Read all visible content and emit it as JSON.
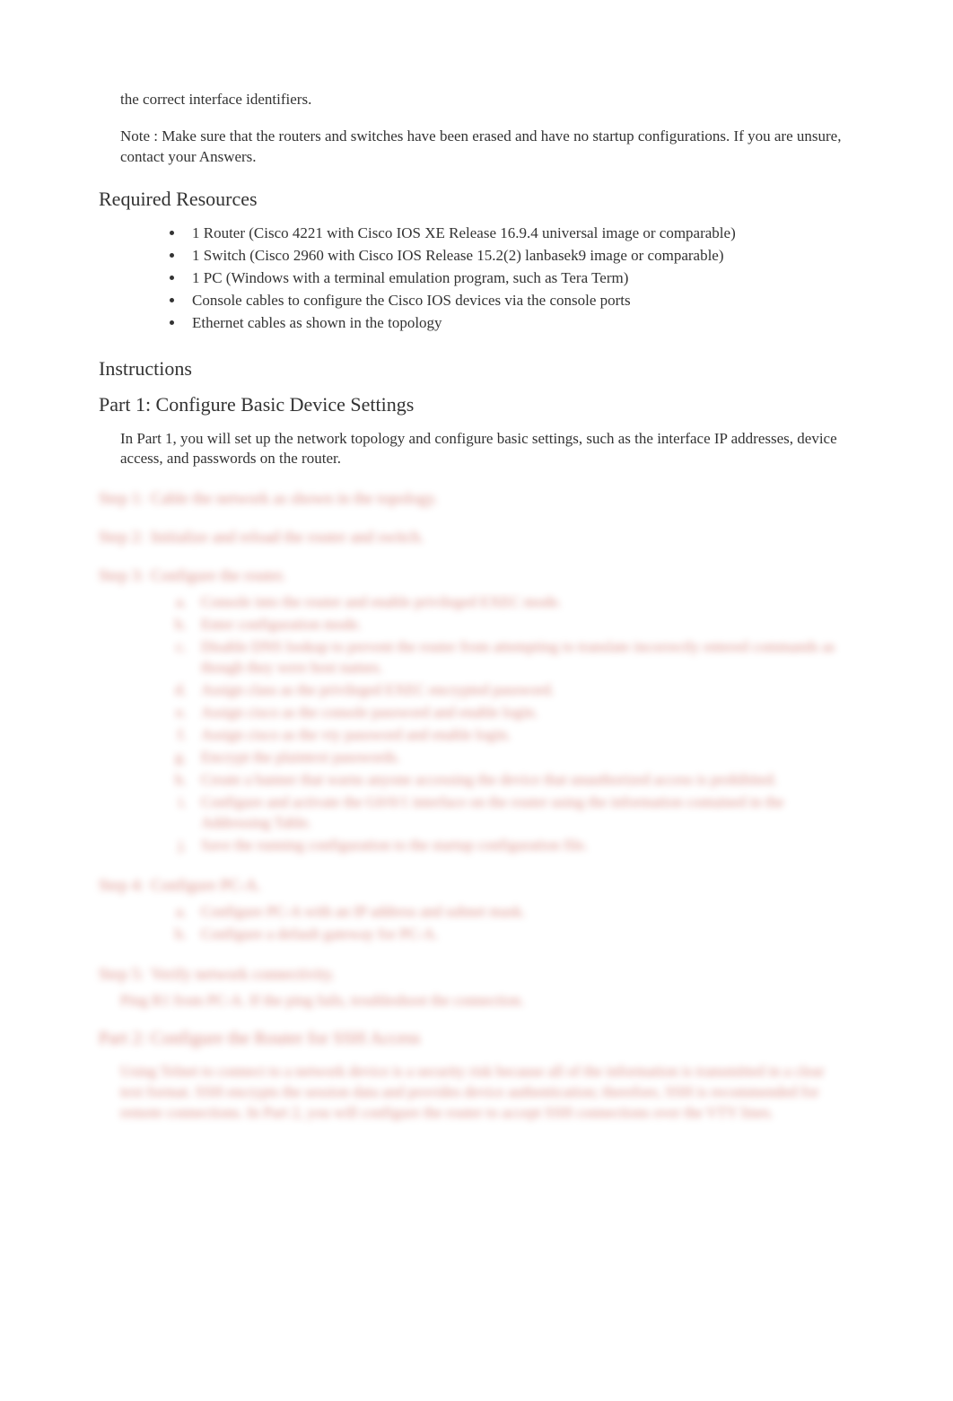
{
  "intro_tail": "the correct interface identifiers.",
  "note": "Note : Make sure that the routers and switches have been erased and have no startup configurations. If you are unsure, contact your Answers.",
  "required_resources_heading": "Required Resources",
  "resources": [
    "1 Router (Cisco 4221 with Cisco IOS XE Release 16.9.4 universal image or comparable)",
    "1 Switch (Cisco 2960 with Cisco IOS Release 15.2(2) lanbasek9 image or comparable)",
    "1 PC (Windows with a terminal emulation program, such as Tera Term)",
    "Console cables to configure the Cisco IOS devices via the console ports",
    "Ethernet cables as shown in the topology"
  ],
  "instructions_heading": "Instructions",
  "part1_heading": "Part 1:   Configure Basic Device Settings",
  "part1_intro": "In Part 1, you will set up the network topology and configure basic settings, such as the interface IP addresses, device access, and passwords on the router.",
  "step1": {
    "label": "Step 1:",
    "title": "Cable the network as shown in the topology."
  },
  "step2": {
    "label": "Step 2:",
    "title": "Initialize and reload the router and switch."
  },
  "step3": {
    "label": "Step 3:",
    "title": "Configure the router.",
    "items": [
      "Console into the router and enable privileged EXEC mode.",
      "Enter configuration mode.",
      "Disable DNS lookup to prevent the router from attempting to translate incorrectly entered commands as though they were host names.",
      "Assign class as the privileged EXEC encrypted password.",
      "Assign cisco as the console password and enable login.",
      "Assign cisco as the vty password and enable login.",
      "Encrypt the plaintext passwords.",
      "Create a banner that warns anyone accessing the device that unauthorized access is prohibited.",
      "Configure and activate the G0/0/1 interface on the router using the information contained in the Addressing Table.",
      "Save the running configuration to the startup configuration file."
    ]
  },
  "step4": {
    "label": "Step 4:",
    "title": "Configure PC-A.",
    "items": [
      "Configure PC-A with an IP address and subnet mask.",
      "Configure a default gateway for PC-A."
    ]
  },
  "step5": {
    "label": "Step 5:",
    "title": "Verify network connectivity.",
    "ping_text": "Ping R1 from PC-A. If the ping fails, troubleshoot the connection."
  },
  "part2_heading": "Part 2:   Configure the Router for SSH Access",
  "part2_intro": "Using Telnet to connect to a network device is a security risk because all of the information is transmitted in a clear text format. SSH encrypts the session data and provides device authentication; therefore, SSH is recommended for remote connections. In Part 2, you will configure the router to accept SSH connections over the VTY lines."
}
